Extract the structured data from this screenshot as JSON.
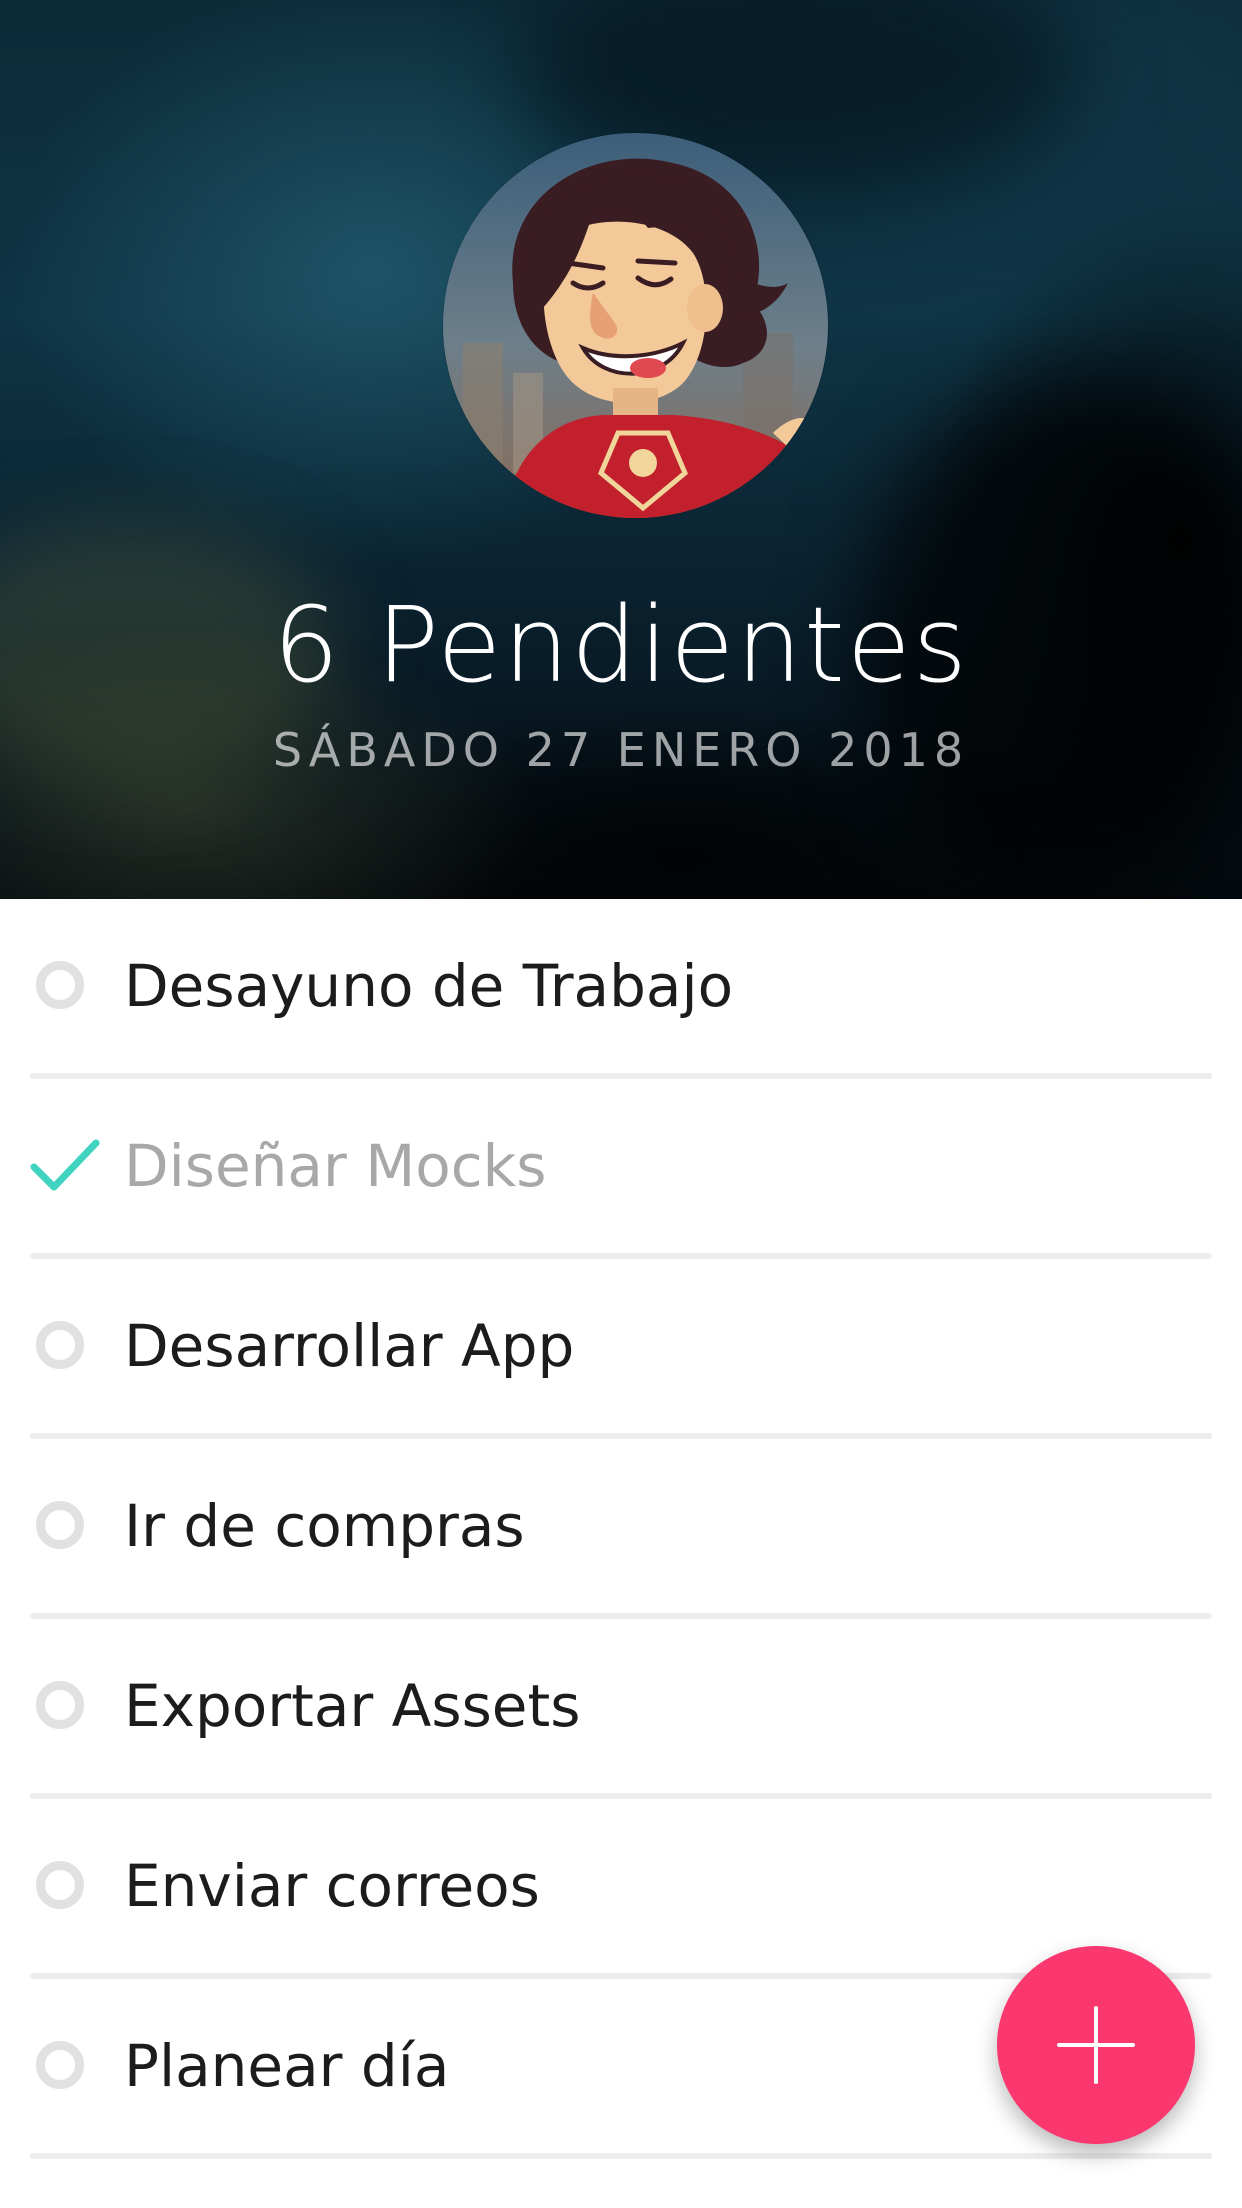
{
  "header": {
    "title": "6 Pendientes",
    "date": "SÁBADO 27 ENERO 2018",
    "avatar_icon": "avatar-illustration-icon"
  },
  "tasks": [
    {
      "label": "Desayuno de Trabajo",
      "done": false
    },
    {
      "label": "Diseñar Mocks",
      "done": true
    },
    {
      "label": "Desarrollar App",
      "done": false
    },
    {
      "label": "Ir de compras",
      "done": false
    },
    {
      "label": "Exportar Assets",
      "done": false
    },
    {
      "label": "Enviar correos",
      "done": false
    },
    {
      "label": "Planear día",
      "done": false
    }
  ],
  "fab": {
    "icon": "plus-icon",
    "color": "#fb3770"
  },
  "colors": {
    "check": "#3fd3c0",
    "radio": "#e1e1e1",
    "done_text": "#a8a8a8",
    "text": "#1c1c1c"
  }
}
